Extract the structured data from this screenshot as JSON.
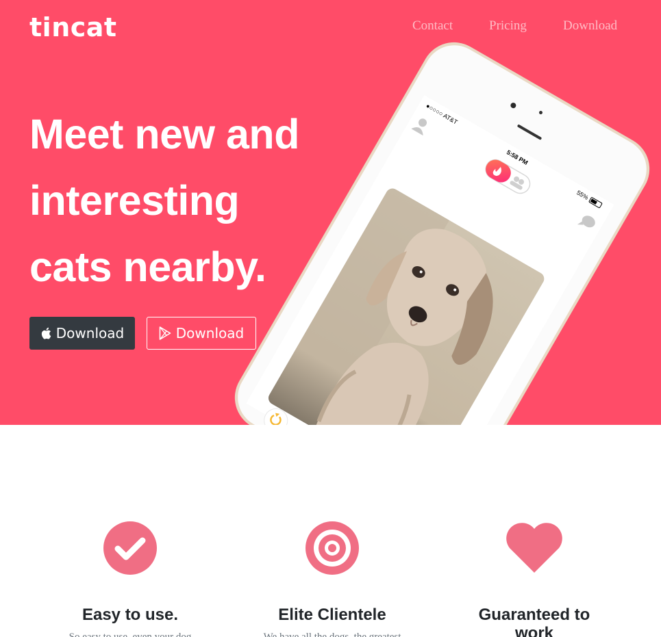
{
  "brand": {
    "logo_text": "tincat"
  },
  "nav": {
    "contact": "Contact",
    "pricing": "Pricing",
    "download": "Download"
  },
  "hero": {
    "headline_line1": "Meet new and",
    "headline_line2": "interesting",
    "headline_line3": "cats nearby.",
    "apple_button": "Download",
    "google_button": "Download"
  },
  "phone_status": {
    "carrier": "●○○○○ AT&T",
    "time": "5:58 PM",
    "battery": "55%"
  },
  "features": [
    {
      "title": "Easy to use.",
      "text": "So easy to use, even your dog",
      "icon": "check-circle-icon"
    },
    {
      "title": "Elite Clientele",
      "text": "We have all the dogs, the greatest",
      "icon": "bullseye-icon"
    },
    {
      "title": "Guaranteed to work",
      "text": "",
      "icon": "heart-icon"
    }
  ],
  "colors": {
    "hero_bg": "#ff4c68",
    "icon_pink": "#f06e84",
    "dark_button": "#343a40"
  }
}
